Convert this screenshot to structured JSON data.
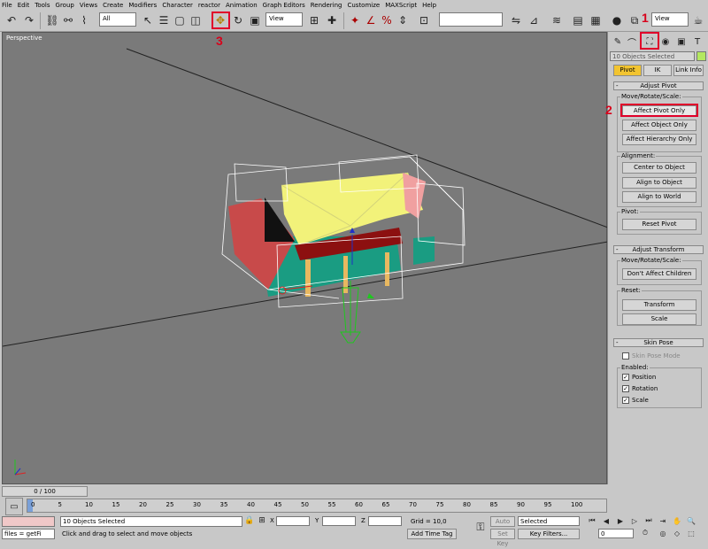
{
  "menu": [
    "File",
    "Edit",
    "Tools",
    "Group",
    "Views",
    "Create",
    "Modifiers",
    "Character",
    "reactor",
    "Animation",
    "Graph Editors",
    "Rendering",
    "Customize",
    "MAXScript",
    "Help"
  ],
  "toolbar": {
    "filter_select": "All",
    "view_select": "View",
    "sel_set": "",
    "view_dd": "View"
  },
  "viewport": {
    "label": "Perspective"
  },
  "markers": {
    "one": "1",
    "two": "2",
    "three": "3"
  },
  "command_panel": {
    "name_field": "10 Objects Selected",
    "tabs": [
      "Pivot",
      "IK",
      "Link Info"
    ],
    "adjust_pivot": {
      "title": "Adjust Pivot",
      "move_group": "Move/Rotate/Scale:",
      "affect_pivot": "Affect Pivot Only",
      "affect_object": "Affect Object Only",
      "affect_hierarchy": "Affect Hierarchy Only",
      "alignment_group": "Alignment:",
      "center_to_object": "Center to Object",
      "align_to_object": "Align to Object",
      "align_to_world": "Align to World",
      "pivot_group": "Pivot:",
      "reset_pivot": "Reset Pivot"
    },
    "adjust_transform": {
      "title": "Adjust Transform",
      "move_group": "Move/Rotate/Scale:",
      "dont_affect": "Don't Affect Children",
      "reset_group": "Reset:",
      "transform": "Transform",
      "scale": "Scale"
    },
    "skin_pose": {
      "title": "Skin Pose",
      "skin_pose_mode": "Skin Pose Mode",
      "enabled_group": "Enabled:",
      "position": "Position",
      "rotation": "Rotation",
      "scale": "Scale"
    }
  },
  "timeline": {
    "slider": "0 / 100",
    "ticks": [
      "0",
      "5",
      "10",
      "15",
      "20",
      "25",
      "30",
      "35",
      "40",
      "45",
      "50",
      "55",
      "60",
      "65",
      "70",
      "75",
      "80",
      "85",
      "90",
      "95",
      "100"
    ]
  },
  "status": {
    "script_field": "files = getFi",
    "selection": "10 Objects Selected",
    "prompt": "Click and drag to select and move objects",
    "x_label": "X",
    "y_label": "Y",
    "z_label": "Z",
    "grid": "Grid = 10,0",
    "add_time_tag": "Add Time Tag",
    "auto_key": "Auto Key",
    "set_key": "Set Key",
    "key_mode": "Selected",
    "key_filters": "Key Filters...",
    "frame": "0"
  }
}
